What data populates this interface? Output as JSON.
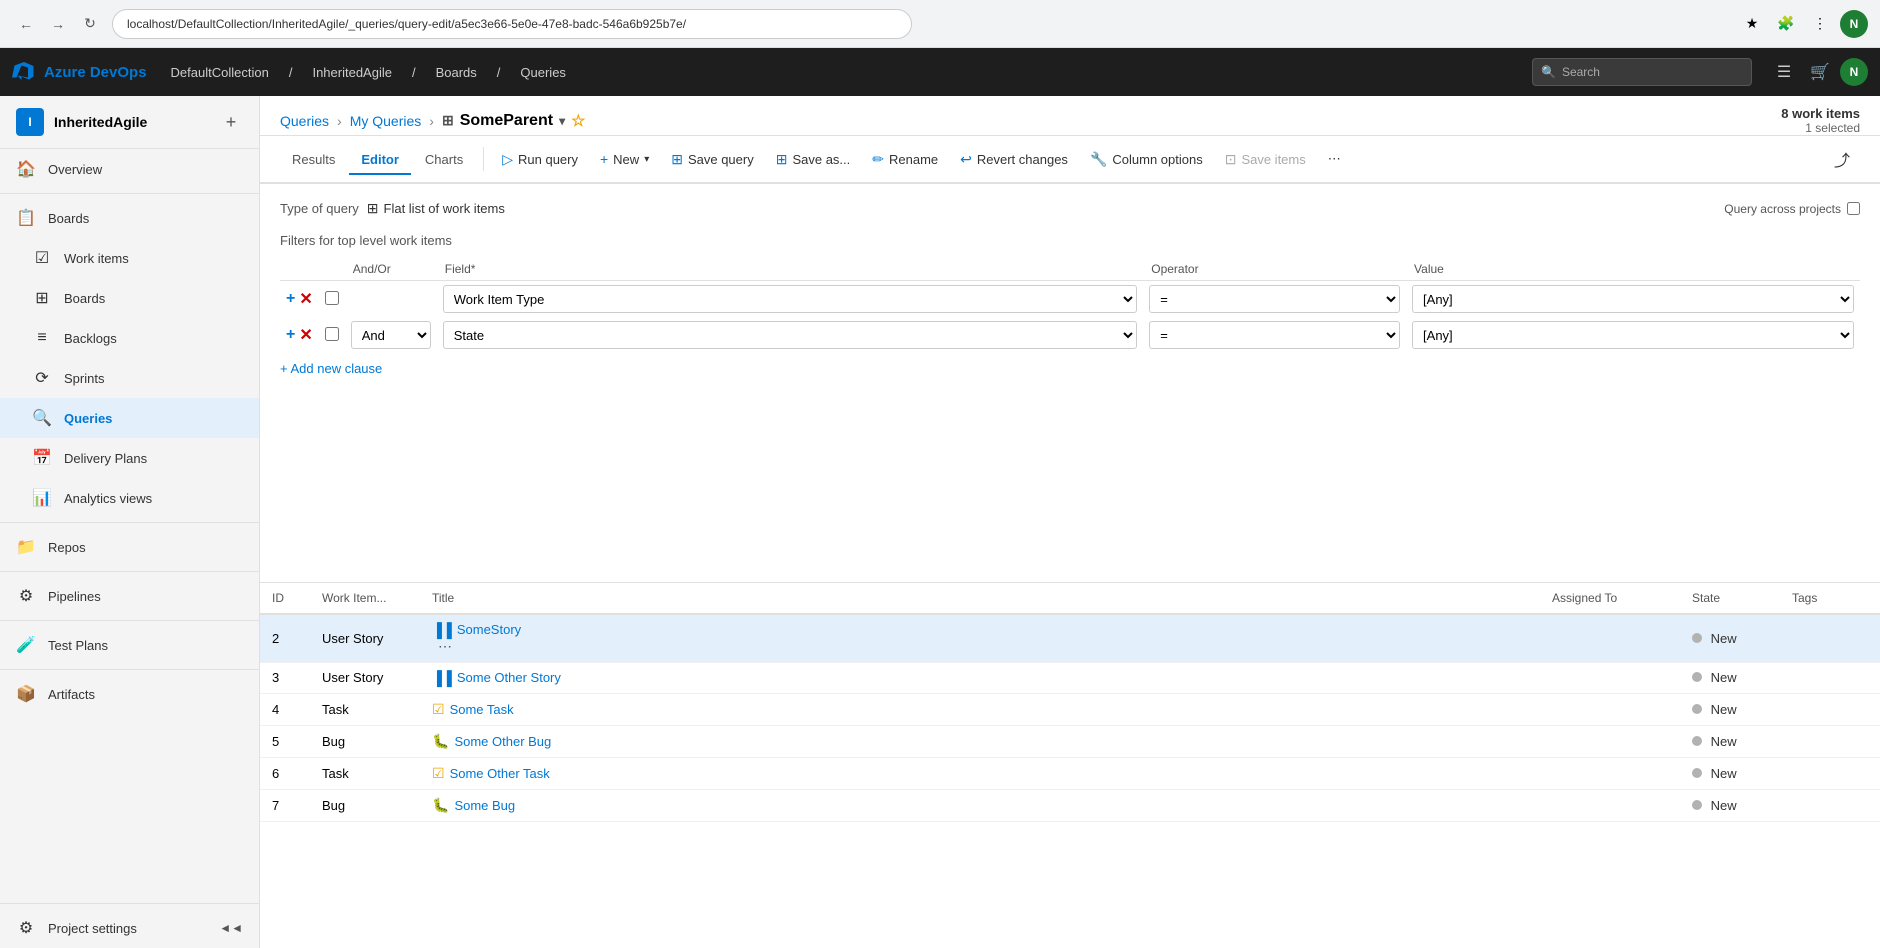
{
  "browser": {
    "url": "localhost/DefaultCollection/InheritedAgile/_queries/query-edit/a5ec3e66-5e0e-47e8-badc-546a6b925b7e/",
    "nav": {
      "back": "←",
      "forward": "→",
      "refresh": "↻"
    }
  },
  "appHeader": {
    "logoText": "Azure DevOps",
    "breadcrumbs": [
      "DefaultCollection",
      "InheritedAgile",
      "Boards",
      "Queries"
    ],
    "breadcrumbSeps": [
      "/",
      "/",
      "/"
    ],
    "searchPlaceholder": "Search",
    "userInitial": "N"
  },
  "sidebar": {
    "projectIcon": "I",
    "projectName": "InheritedAgile",
    "navItems": [
      {
        "id": "overview",
        "label": "Overview",
        "icon": "🏠"
      },
      {
        "id": "boards-section",
        "label": "Boards",
        "icon": "📋"
      },
      {
        "id": "work-items",
        "label": "Work items",
        "icon": "☑"
      },
      {
        "id": "boards",
        "label": "Boards",
        "icon": "⊞"
      },
      {
        "id": "backlogs",
        "label": "Backlogs",
        "icon": "≡"
      },
      {
        "id": "sprints",
        "label": "Sprints",
        "icon": "⟳"
      },
      {
        "id": "queries",
        "label": "Queries",
        "icon": "🔍",
        "active": true
      },
      {
        "id": "delivery-plans",
        "label": "Delivery Plans",
        "icon": "📅"
      },
      {
        "id": "analytics-views",
        "label": "Analytics views",
        "icon": "📊"
      },
      {
        "id": "repos",
        "label": "Repos",
        "icon": "📁"
      },
      {
        "id": "pipelines",
        "label": "Pipelines",
        "icon": "⚙"
      },
      {
        "id": "test-plans",
        "label": "Test Plans",
        "icon": "🧪"
      },
      {
        "id": "artifacts",
        "label": "Artifacts",
        "icon": "📦"
      }
    ],
    "settingsLabel": "Project settings",
    "collapseLabel": "Collapse"
  },
  "queryPage": {
    "breadcrumbs": [
      "Queries",
      "My Queries",
      "SomeParent"
    ],
    "queryName": "SomeParent",
    "workItemsCount": "8 work items",
    "selectedCount": "1 selected",
    "tabs": [
      {
        "id": "results",
        "label": "Results"
      },
      {
        "id": "editor",
        "label": "Editor",
        "active": true
      },
      {
        "id": "charts",
        "label": "Charts"
      }
    ],
    "toolbar": {
      "runQuery": "Run query",
      "new": "New",
      "saveQuery": "Save query",
      "saveAs": "Save as...",
      "rename": "Rename",
      "revertChanges": "Revert changes",
      "columnOptions": "Column options",
      "saveItems": "Save items",
      "more": "..."
    },
    "editor": {
      "typeOfQueryLabel": "Type of query",
      "typeOfQueryValue": "Flat list of work items",
      "filtersLabel": "Filters for top level work items",
      "filterColumns": {
        "andOr": "And/Or",
        "field": "Field*",
        "operator": "Operator",
        "value": "Value"
      },
      "filterRows": [
        {
          "id": 1,
          "andOr": "",
          "field": "Work Item Type",
          "operator": "=",
          "value": "[Any]"
        },
        {
          "id": 2,
          "andOr": "And",
          "field": "State",
          "operator": "=",
          "value": "[Any]"
        }
      ],
      "addClauseLabel": "+ Add new clause",
      "queryAcrossLabel": "Query across projects"
    },
    "results": {
      "columns": [
        "ID",
        "Work Item...",
        "Title",
        "Assigned To",
        "State",
        "Tags"
      ],
      "rows": [
        {
          "id": "2",
          "type": "User Story",
          "typeIcon": "user-story",
          "title": "SomeStory",
          "assignedTo": "",
          "state": "New",
          "tags": "",
          "selected": true
        },
        {
          "id": "3",
          "type": "User Story",
          "typeIcon": "user-story",
          "title": "Some Other Story",
          "assignedTo": "",
          "state": "New",
          "tags": ""
        },
        {
          "id": "4",
          "type": "Task",
          "typeIcon": "task",
          "title": "Some Task",
          "assignedTo": "",
          "state": "New",
          "tags": ""
        },
        {
          "id": "5",
          "type": "Bug",
          "typeIcon": "bug",
          "title": "Some Other Bug",
          "assignedTo": "",
          "state": "New",
          "tags": ""
        },
        {
          "id": "6",
          "type": "Task",
          "typeIcon": "task",
          "title": "Some Other Task",
          "assignedTo": "",
          "state": "New",
          "tags": ""
        },
        {
          "id": "7",
          "type": "Bug",
          "typeIcon": "bug",
          "title": "Some Bug",
          "assignedTo": "",
          "state": "New",
          "tags": ""
        }
      ]
    }
  }
}
